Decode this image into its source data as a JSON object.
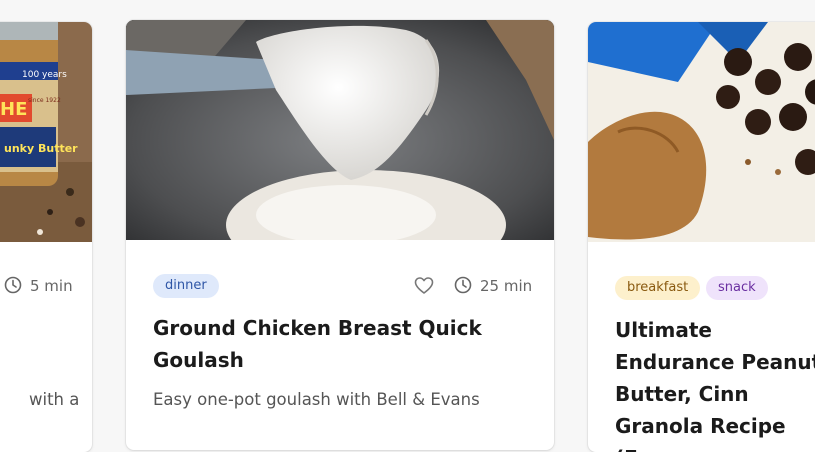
{
  "cards": [
    {
      "time": "5 min",
      "description_partial": "with a"
    },
    {
      "tags": [
        "dinner"
      ],
      "time": "25 min",
      "title": "Ground Chicken Breast Quick Goulash",
      "description": "Easy one-pot goulash with Bell & Evans"
    },
    {
      "tags": [
        "breakfast",
        "snack"
      ],
      "title": "Ultimate Endurance Peanut Butter, Cinn Granola Recipe (Fu"
    }
  ],
  "jar_label": {
    "brand": "HE",
    "years": "100 years",
    "since": "since 1922",
    "kind": "unky Butter"
  },
  "colors": {
    "tag_dinner_bg": "#dfe9fb",
    "tag_dinner_text": "#2f56a6",
    "tag_breakfast_bg": "#fdf0cc",
    "tag_breakfast_text": "#8a5a10",
    "tag_snack_bg": "#efe3fb",
    "tag_snack_text": "#6a2fa1"
  },
  "icons": [
    "clock-icon",
    "heart-icon"
  ]
}
